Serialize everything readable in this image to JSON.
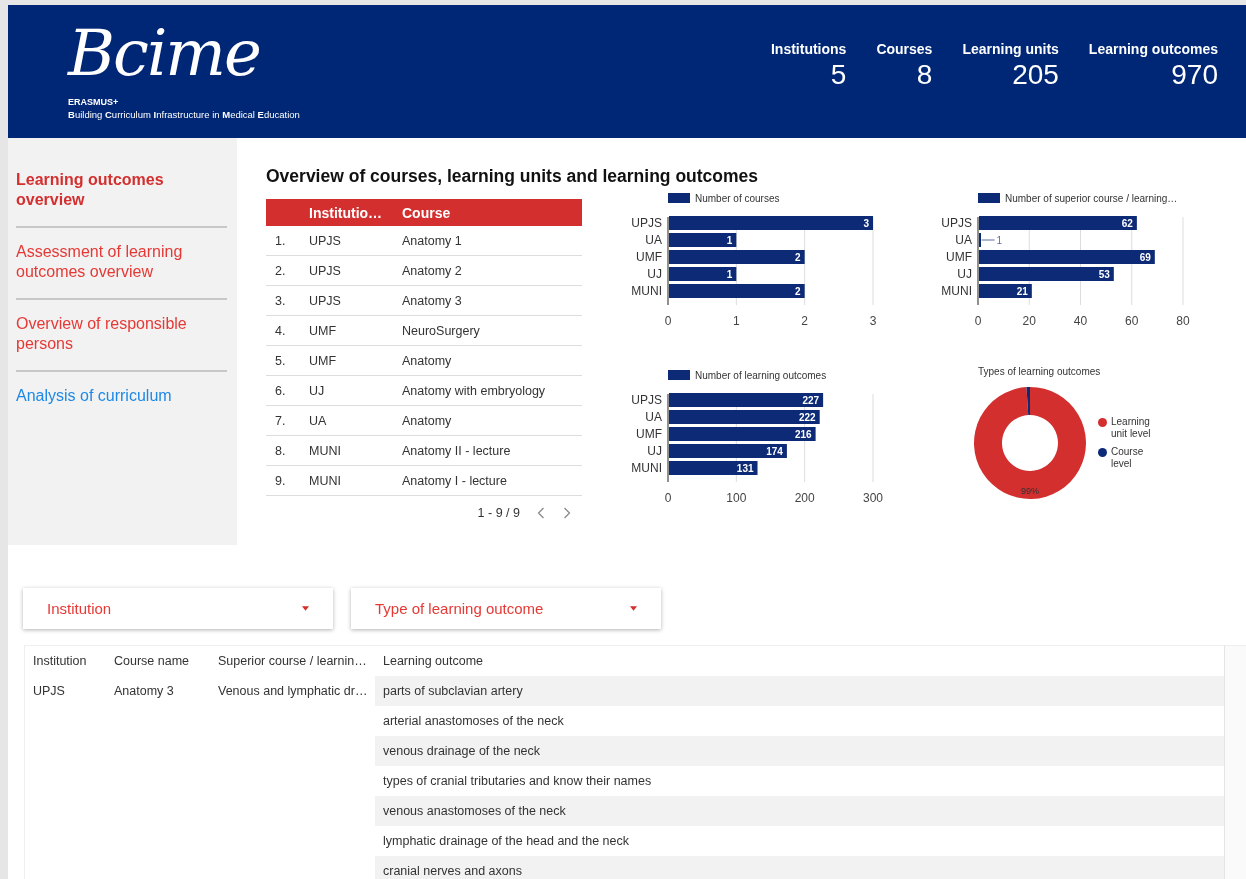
{
  "header": {
    "logo": "Bcime",
    "program": "ERASMUS+",
    "subtitle": "**B**uilding **C**urriculum **I**nfrastructure in **M**edical **E**ducation",
    "stats": [
      {
        "label": "Institutions",
        "value": "5"
      },
      {
        "label": "Courses",
        "value": "8"
      },
      {
        "label": "Learning units",
        "value": "205"
      },
      {
        "label": "Learning outcomes",
        "value": "970"
      }
    ]
  },
  "sidebar": {
    "items": [
      {
        "label": "Learning outcomes overview",
        "selected": true,
        "kind": "page"
      },
      {
        "label": "Assessment of learning outcomes overview",
        "selected": false,
        "kind": "page"
      },
      {
        "label": "Overview of responsible persons",
        "selected": false,
        "kind": "page"
      },
      {
        "label": "Analysis of curriculum",
        "selected": false,
        "kind": "link"
      }
    ]
  },
  "main": {
    "title": "Overview of courses, learning units and learning outcomes",
    "courses_table": {
      "columns": [
        "Institutio…",
        "Course"
      ],
      "rows": [
        {
          "index": "1.",
          "institution": "UPJS",
          "course": "Anatomy 1"
        },
        {
          "index": "2.",
          "institution": "UPJS",
          "course": "Anatomy 2"
        },
        {
          "index": "3.",
          "institution": "UPJS",
          "course": "Anatomy 3"
        },
        {
          "index": "4.",
          "institution": "UMF",
          "course": "NeuroSurgery"
        },
        {
          "index": "5.",
          "institution": "UMF",
          "course": "Anatomy"
        },
        {
          "index": "6.",
          "institution": "UJ",
          "course": "Anatomy with embryology"
        },
        {
          "index": "7.",
          "institution": "UA",
          "course": "Anatomy"
        },
        {
          "index": "8.",
          "institution": "MUNI",
          "course": "Anatomy II - lecture"
        },
        {
          "index": "9.",
          "institution": "MUNI",
          "course": "Anatomy I - lecture"
        }
      ],
      "pagination": "1 - 9 / 9"
    },
    "charts": [
      {
        "chart_data": {
          "type": "bar",
          "orientation": "horizontal",
          "categories": [
            "UPJS",
            "UA",
            "UMF",
            "UJ",
            "MUNI"
          ],
          "series": [
            {
              "name": "Number of courses",
              "color": "#0d2a77",
              "values": [
                3,
                1,
                2,
                1,
                2
              ]
            }
          ],
          "xlim": [
            0,
            3
          ],
          "xticks": [
            0,
            1,
            2,
            3
          ],
          "data_labels": true,
          "grid": true,
          "legend": "top"
        }
      },
      {
        "chart_data": {
          "type": "bar",
          "orientation": "horizontal",
          "categories": [
            "UPJS",
            "UA",
            "UMF",
            "UJ",
            "MUNI"
          ],
          "series": [
            {
              "name": "Number of superior course / learning…",
              "color": "#0d2a77",
              "values": [
                62,
                1,
                69,
                53,
                21
              ]
            }
          ],
          "xlim": [
            0,
            80
          ],
          "xticks": [
            0,
            20,
            40,
            60,
            80
          ],
          "data_labels": true,
          "grid": true,
          "legend": "top"
        }
      },
      {
        "chart_data": {
          "type": "bar",
          "orientation": "horizontal",
          "categories": [
            "UPJS",
            "UA",
            "UMF",
            "UJ",
            "MUNI"
          ],
          "series": [
            {
              "name": "Number of learning outcomes",
              "color": "#0d2a77",
              "values": [
                227,
                222,
                216,
                174,
                131
              ]
            }
          ],
          "xlim": [
            0,
            300
          ],
          "xticks": [
            0,
            100,
            200,
            300
          ],
          "data_labels": true,
          "grid": true,
          "legend": "top"
        }
      },
      {
        "chart_data": {
          "type": "donut",
          "title": "Types of learning outcomes",
          "categories": [
            "Learning unit level",
            "Course level"
          ],
          "series": [
            {
              "values": [
                99,
                1
              ]
            }
          ],
          "colors": [
            "#d32f2f",
            "#0d2a77"
          ],
          "value_labels": [
            "99%",
            null
          ],
          "legend": "right"
        }
      }
    ]
  },
  "filters": [
    {
      "label": "Institution"
    },
    {
      "label": "Type of learning outcome"
    }
  ],
  "outcomes_table": {
    "columns": [
      "Institution",
      "Course name",
      "Superior course / learnin…",
      "Learning outcome"
    ],
    "group": {
      "institution": "UPJS",
      "course": "Anatomy 3",
      "superior": "Venous and lymphatic dr…"
    },
    "outcomes": [
      "parts of subclavian artery",
      "arterial anastomoses of the neck",
      "venous drainage of the neck",
      "types of cranial tributaries and know their names",
      "venous anastomoses of the neck",
      "lymphatic drainage of the head and the neck",
      "cranial nerves and axons"
    ]
  }
}
